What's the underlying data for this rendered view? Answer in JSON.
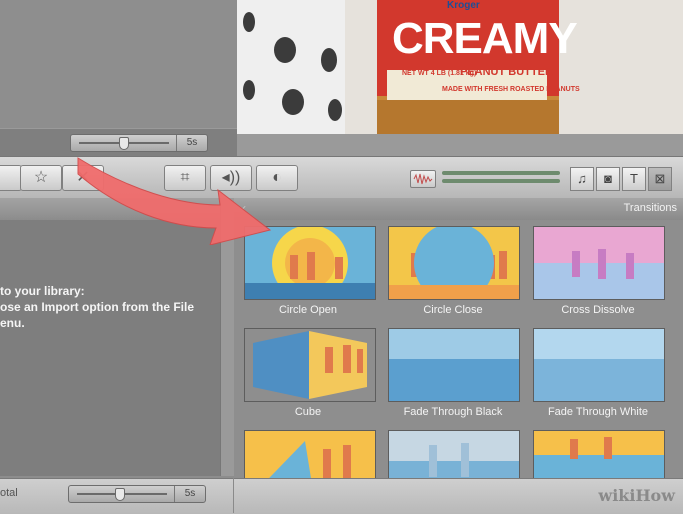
{
  "project_area": {
    "zoom_value": "5s"
  },
  "viewer": {
    "jar_brand": "Kroger",
    "jar_title": "CREAMY",
    "jar_subtitle": "PEANUT BUTTER",
    "jar_weight": "NET WT 4 LB (1.81 kg)",
    "jar_note": "MADE WITH FRESH ROASTED PEANUTS"
  },
  "library": {
    "message_line1": "to your library:",
    "message_line2": "ose an Import option from the File",
    "message_line3": "enu."
  },
  "transitions": {
    "title": "Transitions",
    "items": [
      {
        "label": "Circle Open"
      },
      {
        "label": "Circle Close"
      },
      {
        "label": "Cross Dissolve"
      },
      {
        "label": "Cube"
      },
      {
        "label": "Fade Through Black"
      },
      {
        "label": "Fade Through White"
      }
    ]
  },
  "bottom": {
    "total_label": "otal",
    "zoom_value": "5s"
  },
  "watermark": "wikiHow",
  "colors": {
    "arrow": "#f06c6c",
    "sky": "#6ab3d8",
    "sunset": "#f6d64a"
  }
}
